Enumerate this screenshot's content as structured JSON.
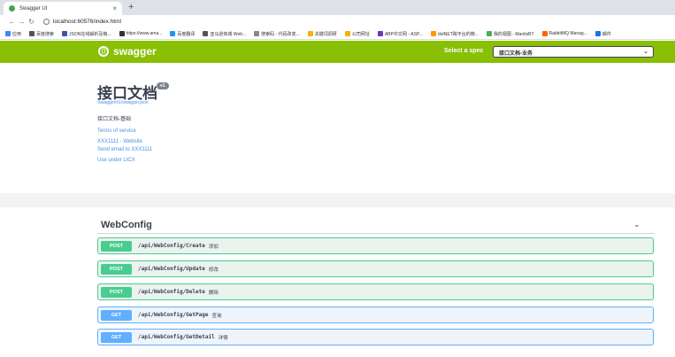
{
  "browser": {
    "tab_title": "Swagger UI",
    "tab_close": "×",
    "new_tab": "+",
    "url": "localhost:60576/index.html",
    "bookmarks": [
      {
        "label": "应用",
        "color": "#4285f4"
      },
      {
        "label": "百度搜索",
        "color": "#555555"
      },
      {
        "label": "JSON在线解析及格...",
        "color": "#3f51b5"
      },
      {
        "label": "https://www.ama...",
        "color": "#333333"
      },
      {
        "label": "百度翻译",
        "color": "#2196f3"
      },
      {
        "label": "亚马逊商城 Web...",
        "color": "#555555"
      },
      {
        "label": "搜索码 - 代码改变...",
        "color": "#888888"
      },
      {
        "label": "关键词调研",
        "color": "#f4b400"
      },
      {
        "label": "公司网址",
        "color": "#f4b400"
      },
      {
        "label": "ABP中文网 - ASP...",
        "color": "#673ab7"
      },
      {
        "label": "dotNET跨平台的微...",
        "color": "#ff9800"
      },
      {
        "label": "我的视图 - MantisBT",
        "color": "#4caf50"
      },
      {
        "label": "RabbitMQ Manag...",
        "color": "#ff6600"
      },
      {
        "label": "邮件",
        "color": "#1a73e8"
      }
    ]
  },
  "topbar": {
    "brand": "swagger",
    "spec_label": "Select a spec",
    "spec_value": "接口文档-业务",
    "color": "#89bf04"
  },
  "info": {
    "title": "接口文档",
    "version": "v1",
    "url": "/swagger/v1/swagger.json",
    "description": "接口文档-基础",
    "terms": "Terms of service",
    "website": "XXX1111 - Website",
    "email": "Send email to XXX1111",
    "license": "Use under LICX"
  },
  "section": {
    "title": "WebConfig",
    "operations": [
      {
        "method": "POST",
        "path": "/api/WebConfig/Create",
        "summary": "添加"
      },
      {
        "method": "POST",
        "path": "/api/WebConfig/Update",
        "summary": "修改"
      },
      {
        "method": "POST",
        "path": "/api/WebConfig/Delete",
        "summary": "删除"
      },
      {
        "method": "GET",
        "path": "/api/WebConfig/GetPage",
        "summary": "查询"
      },
      {
        "method": "GET",
        "path": "/api/WebConfig/GetDetail",
        "summary": "详情"
      }
    ]
  }
}
